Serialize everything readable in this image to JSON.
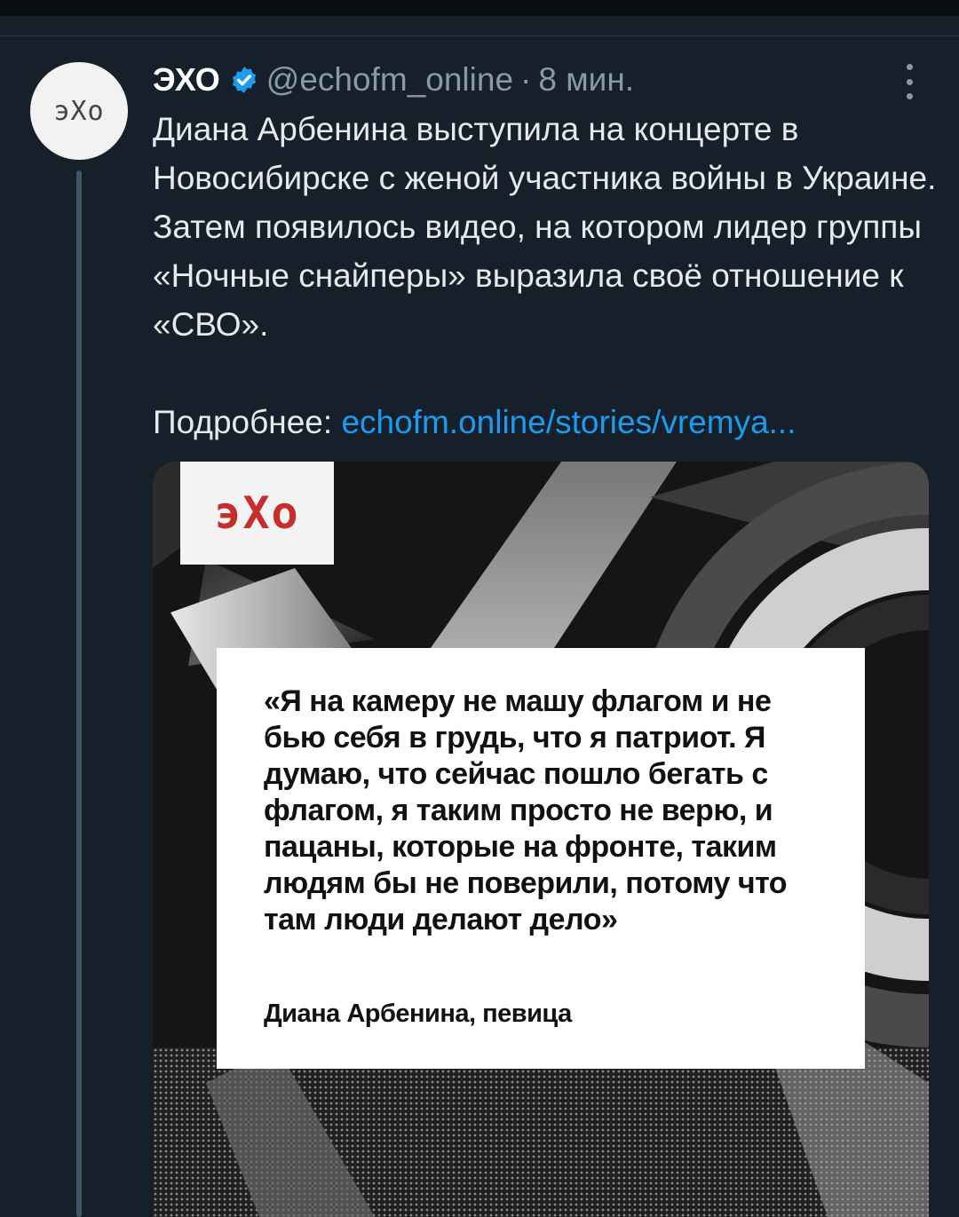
{
  "tweet": {
    "author": {
      "display_name": "ЭХО",
      "handle": "@echofm_online",
      "avatar_logo": "эХо",
      "verified": true
    },
    "separator": "·",
    "time": "8 мин.",
    "text": "Диана Арбенина выступила на концерте в Новосибирске с женой участника войны в Украине. Затем появилось видео, на котором лидер группы «Ночные снайперы» выразила своё отношение к «СВО».",
    "more_label": "Подробнее:",
    "link": "echofm.online/stories/vremya...",
    "more_icon": "more-vertical-icon"
  },
  "card": {
    "logo": "эХо",
    "quote": "«Я на камеру не машу флагом и не бью себя в грудь, что я патриот. Я думаю, что сейчас пошло бегать с флагом, я таким просто не верю, и пацаны, которые на фронте, таким людям бы не поверили, потому что там люди делают дело»",
    "attribution": "Диана Арбенина, певица"
  },
  "colors": {
    "background": "#15202b",
    "link": "#1d9bf0",
    "verified": "#1d9bf0",
    "muted": "#8b98a5",
    "logo_red": "#c62d2d"
  }
}
